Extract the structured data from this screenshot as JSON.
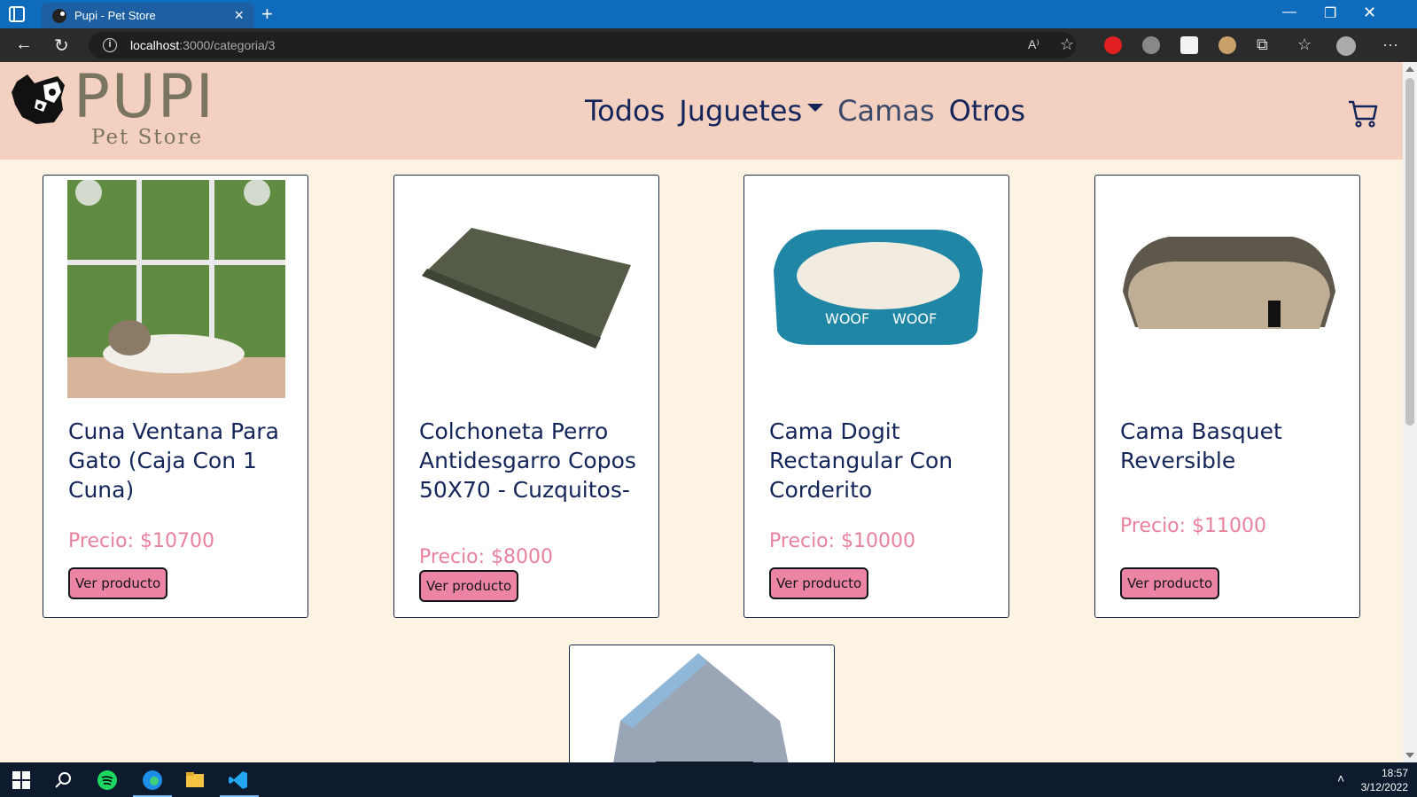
{
  "browser": {
    "tab_title": "Pupi - Pet Store",
    "url_host": "localhost",
    "url_path": ":3000/categoria/3"
  },
  "site": {
    "logo_word": "PUPI",
    "logo_sub": "Pet Store",
    "nav": [
      {
        "label": "Todos"
      },
      {
        "label": "Juguetes"
      },
      {
        "label": "Camas"
      },
      {
        "label": "Otros"
      }
    ]
  },
  "products": [
    {
      "title": "Cuna Ventana Para Gato (Caja Con 1 Cuna)",
      "price": "Precio: $10700",
      "button": "Ver producto"
    },
    {
      "title": "Colchoneta Perro Antidesgarro Copos 50X70 - Cuzquitos-",
      "price": "Precio: $8000",
      "button": "Ver producto"
    },
    {
      "title": "Cama Dogit Rectangular Con Corderito",
      "price": "Precio: $10000",
      "button": "Ver producto"
    },
    {
      "title": "Cama Basquet Reversible",
      "price": "Precio: $11000",
      "button": "Ver producto"
    }
  ],
  "taskbar": {
    "time": "18:57",
    "date": "3/12/2022"
  },
  "colors": {
    "header_bg": "#f4d0c1",
    "page_bg": "#fdf3e3",
    "nav_text": "#14255a",
    "price": "#e8829c",
    "button_bg": "#ec85a3"
  }
}
